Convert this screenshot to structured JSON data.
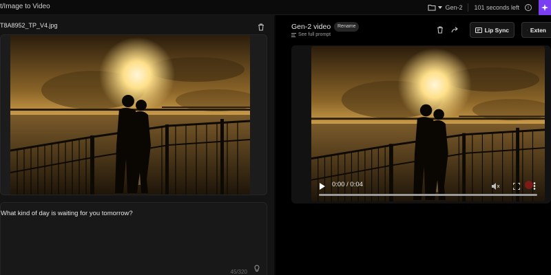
{
  "header": {
    "breadcrumb": "t/Image to Video",
    "model": "Gen-2",
    "seconds_left": "101 seconds left"
  },
  "left_panel": {
    "file_name": "T8A8952_TP_V4.jpg",
    "prompt_text": "What kind of day is waiting for you tomorrow?",
    "char_count": "45/320"
  },
  "right_panel": {
    "title": "Gen-2 video",
    "rename_label": "Rename",
    "see_prompt_label": "See full prompt",
    "lip_sync_label": "Lip Sync",
    "extend_label": "Exten"
  },
  "video": {
    "time": "0:00 / 0:04",
    "progress": 0
  },
  "colors": {
    "accent": "#7b3ff2",
    "background": "#000000",
    "panel": "#141414"
  },
  "icons": [
    "folder-icon",
    "chevron-down-icon",
    "info-icon",
    "magic-icon",
    "trash-icon",
    "share-icon",
    "lip-sync-icon",
    "extend-icon",
    "play-icon",
    "volume-icon",
    "fullscreen-icon",
    "more-icon",
    "lightbulb-icon",
    "menu-lines-icon"
  ]
}
